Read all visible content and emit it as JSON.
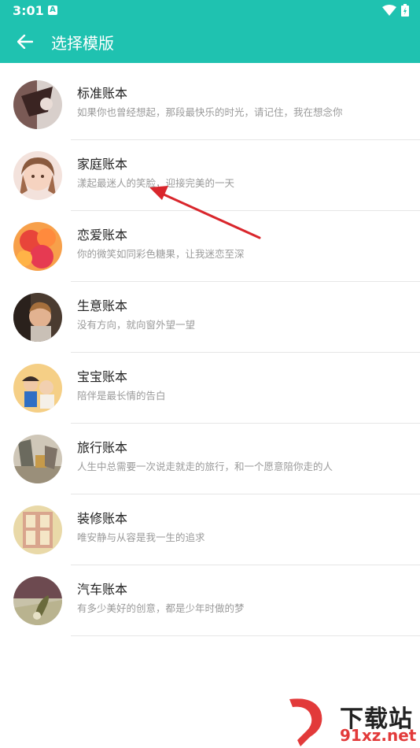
{
  "status": {
    "time": "3:01",
    "notif_letter": "A"
  },
  "appbar": {
    "title": "选择模版"
  },
  "items": [
    {
      "title": "标准账本",
      "subtitle": "如果你也曾经想起，那段最快乐的时光，请记住，我在想念你"
    },
    {
      "title": "家庭账本",
      "subtitle": "漾起最迷人的笑脸，迎接完美的一天"
    },
    {
      "title": "恋爱账本",
      "subtitle": "你的微笑如同彩色糖果，让我迷恋至深"
    },
    {
      "title": "生意账本",
      "subtitle": "没有方向，就向窗外望一望"
    },
    {
      "title": "宝宝账本",
      "subtitle": "陪伴是最长情的告白"
    },
    {
      "title": "旅行账本",
      "subtitle": "人生中总需要一次说走就走的旅行，和一个愿意陪你走的人"
    },
    {
      "title": "装修账本",
      "subtitle": "唯安静与从容是我一生的追求"
    },
    {
      "title": "汽车账本",
      "subtitle": "有多少美好的创意，都是少年时做的梦"
    }
  ],
  "watermark": {
    "line1": "下载站",
    "line2": "91xz.net"
  },
  "colors": {
    "accent": "#1fc2b0",
    "arrow": "#d9262c"
  }
}
